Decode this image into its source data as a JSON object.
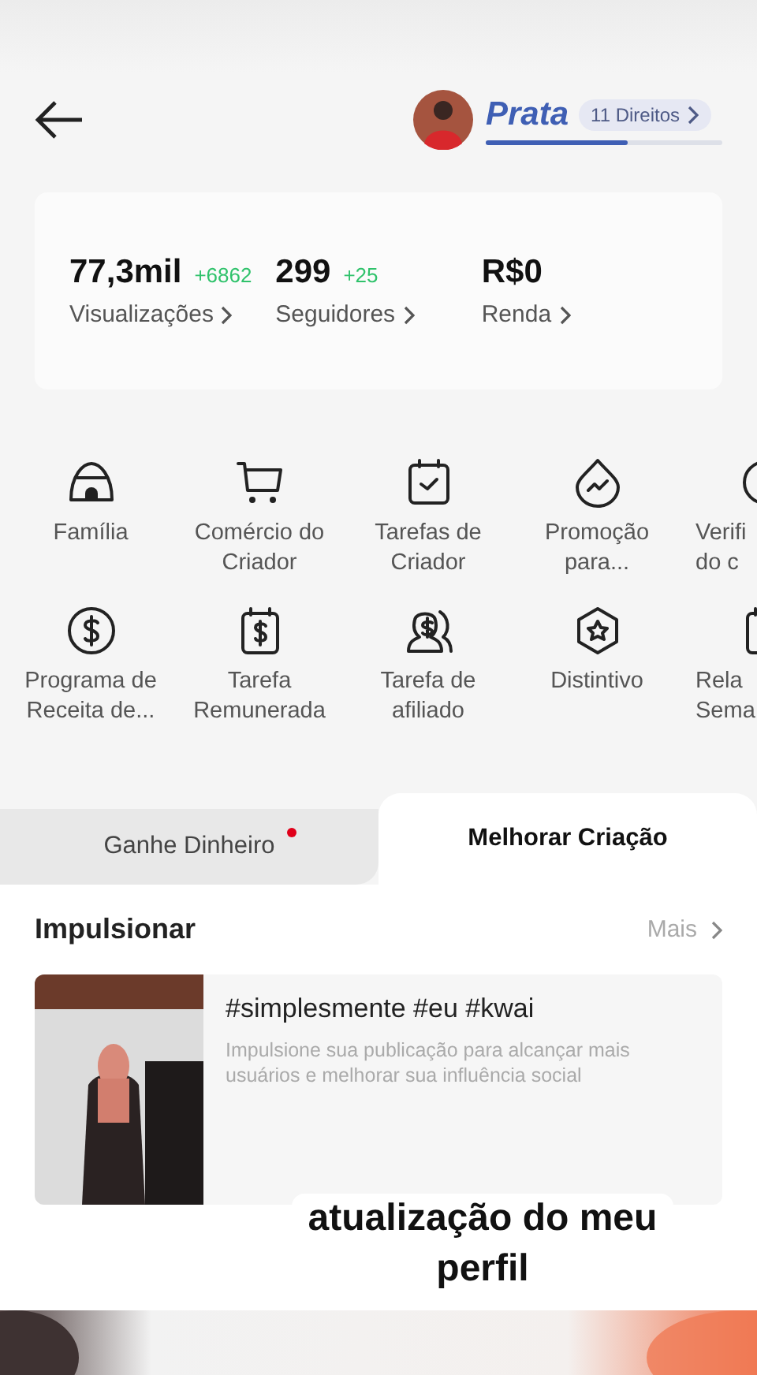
{
  "header": {
    "rank": "Prata",
    "rights": "11 Direitos",
    "level": 0.6
  },
  "stats": [
    {
      "value": "77,3mil",
      "delta": "+6862",
      "label": "Visualizações"
    },
    {
      "value": "299",
      "delta": "+25",
      "label": "Seguidores"
    },
    {
      "value": "R$0",
      "label": "Renda"
    }
  ],
  "tools": [
    {
      "kind": "igloo",
      "lines": [
        "Família"
      ]
    },
    {
      "kind": "cart",
      "lines": [
        "Comércio do",
        "Criador"
      ]
    },
    {
      "kind": "calendar-check",
      "lines": [
        "Tarefas de",
        "Criador"
      ]
    },
    {
      "kind": "drop",
      "lines": [
        "Promoção",
        "para..."
      ]
    },
    {
      "kind": "circle",
      "lines": [
        "Verifi",
        "do c"
      ]
    },
    {
      "kind": "dollar",
      "lines": [
        "Programa de",
        "Receita de..."
      ]
    },
    {
      "kind": "calendar-dollar",
      "lines": [
        "Tarefa",
        "Remunerada"
      ]
    },
    {
      "kind": "people-dollar",
      "lines": [
        "Tarefa de",
        "afiliado"
      ]
    },
    {
      "kind": "badge",
      "lines": [
        "Distintivo"
      ]
    },
    {
      "kind": "calendar",
      "lines": [
        "Rela",
        "Sema"
      ]
    }
  ],
  "tabs": [
    {
      "label": "Ganhe Dinheiro",
      "selected": false,
      "dot": true
    },
    {
      "label": "Melhorar Criação",
      "selected": true,
      "dot": false
    }
  ],
  "section": {
    "title": "Impulsionar",
    "more": "Mais"
  },
  "post": {
    "title": "#simplesmente #eu #kwai",
    "description": "Impulsione sua publicação para alcançar mais usuários e melhorar sua influência social"
  },
  "caption": [
    "atualização do meu",
    "perfil"
  ]
}
